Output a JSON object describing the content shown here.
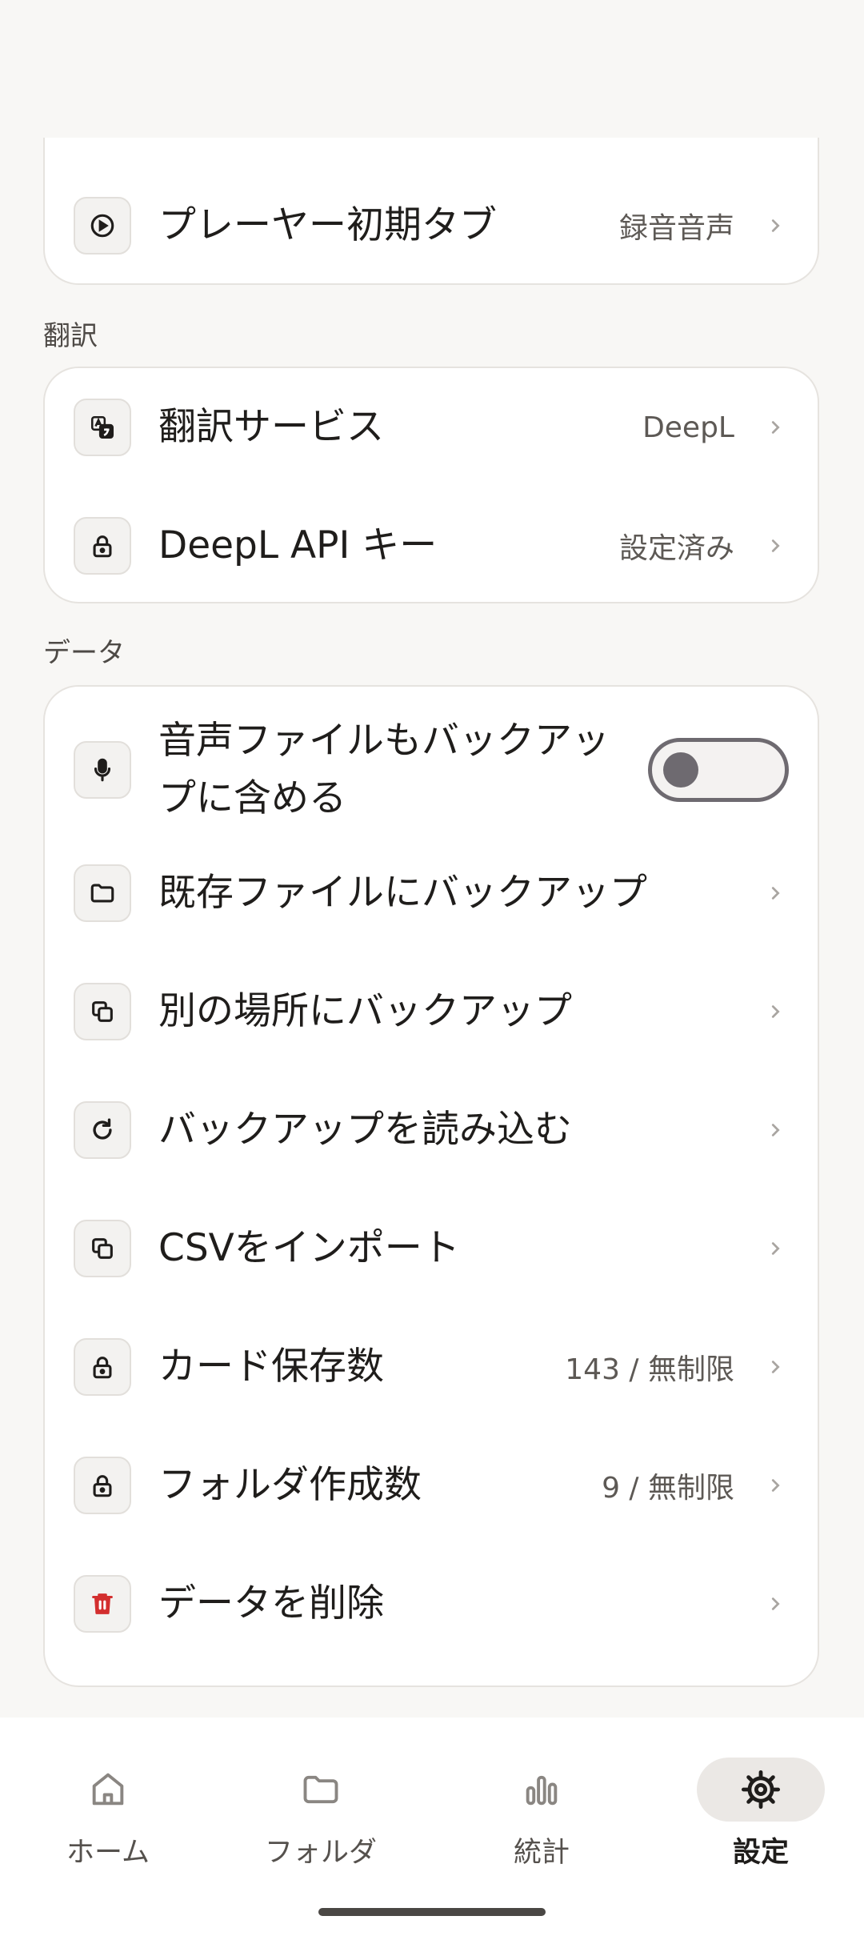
{
  "playback_card": {
    "player_tab": {
      "label": "プレーヤー初期タブ",
      "value": "録音音声",
      "icon": "play-circle-icon"
    }
  },
  "translation_section": {
    "title": "翻訳",
    "items": [
      {
        "label": "翻訳サービス",
        "value": "DeepL",
        "icon": "translate-icon"
      },
      {
        "label": "DeepL API キー",
        "value": "設定済み",
        "icon": "lock-icon"
      }
    ]
  },
  "data_section": {
    "title": "データ",
    "backup_audio": {
      "label": "音声ファイルもバックアップに含める",
      "icon": "microphone-icon",
      "enabled": false
    },
    "items": [
      {
        "label": "既存ファイルにバックアップ",
        "value": "",
        "icon": "folder-icon"
      },
      {
        "label": "別の場所にバックアップ",
        "value": "",
        "icon": "copy-icon"
      },
      {
        "label": "バックアップを読み込む",
        "value": "",
        "icon": "refresh-icon"
      },
      {
        "label": "CSVをインポート",
        "value": "",
        "icon": "copy-icon"
      },
      {
        "label": "カード保存数",
        "value": "143 / 無制限",
        "icon": "lock-icon"
      },
      {
        "label": "フォルダ作成数",
        "value": "9 / 無制限",
        "icon": "lock-icon"
      },
      {
        "label": "データを削除",
        "value": "",
        "icon": "trash-icon",
        "color": "#d32f2f"
      }
    ]
  },
  "bottom_nav": {
    "items": [
      {
        "label": "ホーム",
        "icon": "home-icon",
        "active": false
      },
      {
        "label": "フォルダ",
        "icon": "folder-icon",
        "active": false
      },
      {
        "label": "統計",
        "icon": "bar-chart-icon",
        "active": false
      },
      {
        "label": "設定",
        "icon": "gear-icon",
        "active": true
      }
    ]
  },
  "colors": {
    "background": "#f8f7f5",
    "card": "#ffffff",
    "danger": "#d32f2f",
    "toggle_off": "#6e6a70"
  }
}
